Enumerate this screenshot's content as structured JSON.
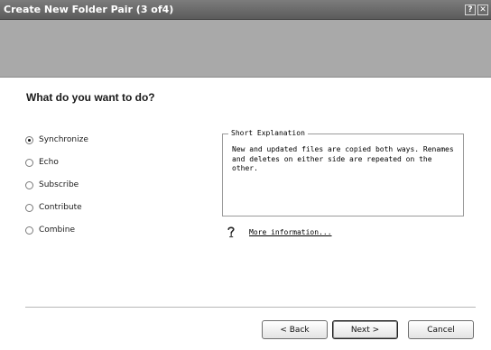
{
  "window": {
    "title": "Create New Folder Pair (3 of4)",
    "help_label": "?",
    "close_label": "✕"
  },
  "wizard": {
    "question": "What do you want to do?",
    "options": [
      {
        "label": "Synchronize",
        "selected": true
      },
      {
        "label": "Echo",
        "selected": false
      },
      {
        "label": "Subscribe",
        "selected": false
      },
      {
        "label": "Contribute",
        "selected": false
      },
      {
        "label": "Combine",
        "selected": false
      }
    ],
    "explanation": {
      "heading": "Short Explanation",
      "text": "New and updated files are copied both ways. Renames and deletes on either side are repeated on the other."
    },
    "more_info": "More information...",
    "buttons": {
      "back": "< Back",
      "next": "Next >",
      "cancel": "Cancel"
    }
  }
}
